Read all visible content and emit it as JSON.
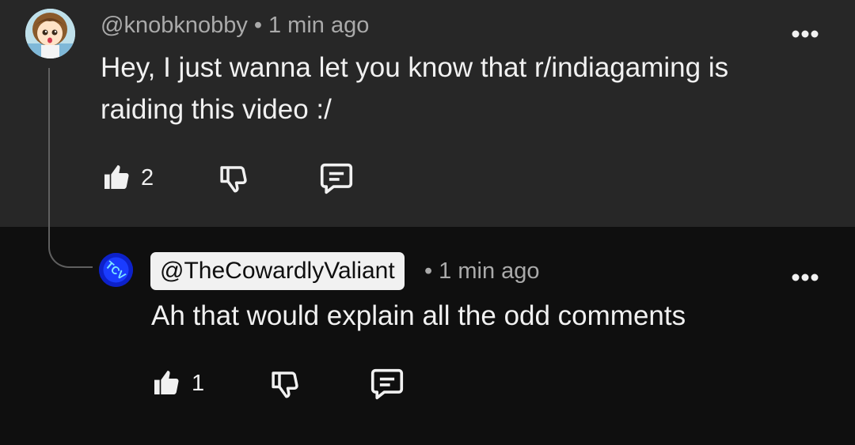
{
  "comment": {
    "author": "@knobknobby",
    "separator": "•",
    "time": "1 min ago",
    "text_line1": "Hey, I just wanna let you know that r/indiagaming is",
    "text_line2": "raiding this video :/",
    "like_count": "2",
    "avatar_icon": "anime-girl-avatar",
    "more_icon": "more-options-icon"
  },
  "reply": {
    "author": "@TheCowardlyValiant",
    "separator": "•",
    "time": "1 min ago",
    "text": "Ah that would explain all the odd comments",
    "like_count": "1",
    "avatar_icon": "tcv-logo-avatar",
    "avatar_letters": "TCV",
    "more_icon": "more-options-icon"
  },
  "colors": {
    "top_background": "#272727",
    "reply_background": "#0f0f0f",
    "text": "#f1f1f1",
    "meta_text": "#aaaaaa",
    "author_highlight": "#f1f1f1",
    "reply_avatar_blue": "#0d21c9"
  }
}
